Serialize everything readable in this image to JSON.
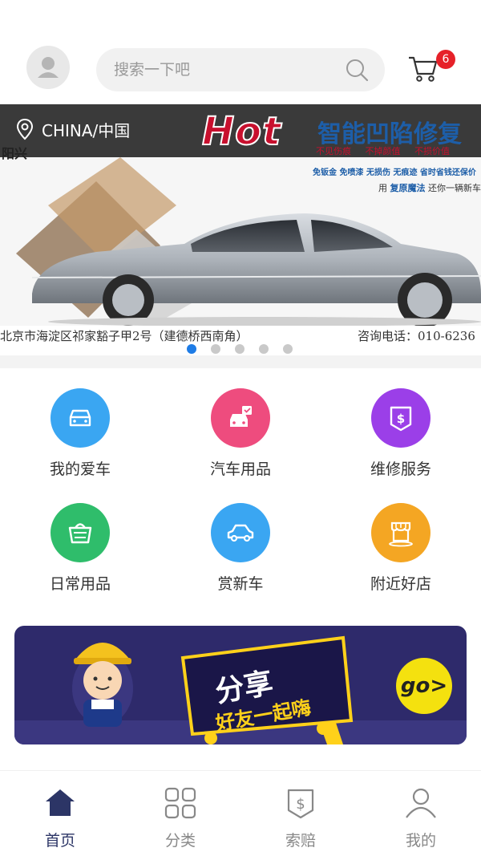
{
  "header": {
    "search_placeholder": "搜索一下吧",
    "cart_badge": "6"
  },
  "banner": {
    "location": "CHINA/中国",
    "brand_fragment": "阳兴",
    "hot_text": "Hot",
    "headline": "智能凹陷修复",
    "features": "不见伤痕 不掉颜值 不损价值",
    "promo": "免钣金 免喷漆 无损伤 无痕迹 省时省钱还保价",
    "magic_prefix": "用",
    "magic_name": "复原魔法",
    "magic_suffix": "还你一辆新车",
    "address": "北京市海淀区祁家豁子甲2号（建德桥西南角）",
    "phone": "咨询电话：010-6236",
    "slides": 5,
    "active_slide": 1
  },
  "categories": [
    {
      "label": "我的爱车",
      "icon": "car-front-icon",
      "color": "#3aa6f2"
    },
    {
      "label": "汽车用品",
      "icon": "car-seat-icon",
      "color": "#ee4c7e"
    },
    {
      "label": "维修服务",
      "icon": "service-shield-icon",
      "color": "#9b3fe8"
    },
    {
      "label": "日常用品",
      "icon": "basket-icon",
      "color": "#2fbd6b"
    },
    {
      "label": "赏新车",
      "icon": "car-side-icon",
      "color": "#3aa6f2"
    },
    {
      "label": "附近好店",
      "icon": "store-icon",
      "color": "#f4a623"
    }
  ],
  "share": {
    "title": "分享",
    "subtitle": "好友一起嗨",
    "go": "go>"
  },
  "nav": [
    {
      "label": "首页",
      "icon": "home-icon",
      "active": true
    },
    {
      "label": "分类",
      "icon": "category-icon",
      "active": false
    },
    {
      "label": "索赔",
      "icon": "claim-icon",
      "active": false
    },
    {
      "label": "我的",
      "icon": "profile-icon",
      "active": false
    }
  ],
  "colors": {
    "accent_blue": "#1e7ce6",
    "badge_red": "#e62129",
    "nav_active": "#2c3566",
    "share_bg": "#2e2a6b"
  }
}
